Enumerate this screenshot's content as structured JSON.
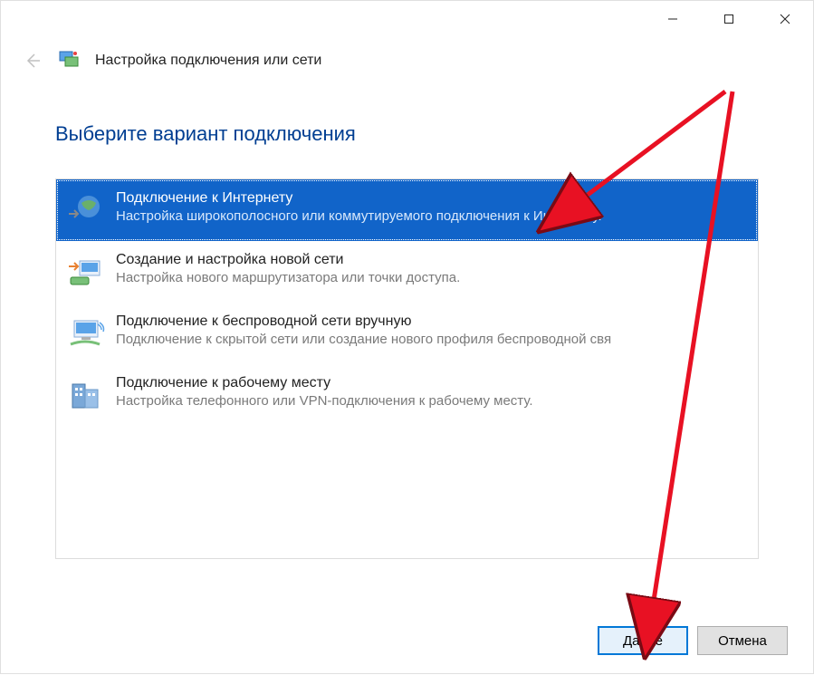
{
  "header": {
    "title": "Настройка подключения или сети"
  },
  "page": {
    "heading": "Выберите вариант подключения"
  },
  "options": [
    {
      "title": "Подключение к Интернету",
      "desc": "Настройка широкополосного или коммутируемого подключения к Интернету.",
      "selected": true
    },
    {
      "title": "Создание и настройка новой сети",
      "desc": "Настройка нового маршрутизатора или точки доступа.",
      "selected": false
    },
    {
      "title": "Подключение к беспроводной сети вручную",
      "desc": "Подключение к скрытой сети или создание нового профиля беспроводной свя",
      "selected": false
    },
    {
      "title": "Подключение к рабочему месту",
      "desc": "Настройка телефонного или VPN-подключения к рабочему месту.",
      "selected": false
    }
  ],
  "footer": {
    "next_label": "Далее",
    "cancel_label": "Отмена"
  }
}
